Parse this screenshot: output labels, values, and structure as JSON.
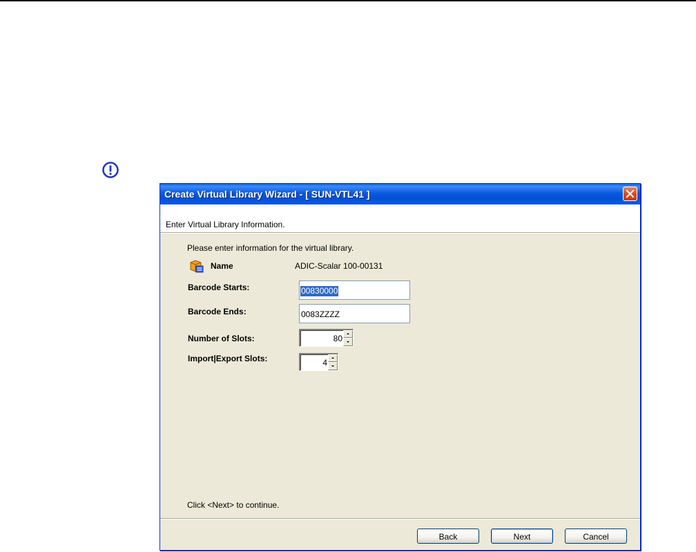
{
  "dialog": {
    "title": "Create Virtual Library Wizard - [ SUN-VTL41 ]",
    "header": "Enter Virtual Library Information.",
    "intro": "Please enter information for the virtual library.",
    "footer": "Click <Next> to continue."
  },
  "fields": {
    "name_label": "Name",
    "name_value": "ADIC-Scalar 100-00131",
    "barcode_starts_label": "Barcode Starts:",
    "barcode_starts_value": "00830000",
    "barcode_ends_label": "Barcode Ends:",
    "barcode_ends_value": "0083ZZZZ",
    "slots_label": "Number of Slots:",
    "slots_value": "80",
    "ie_slots_label": "Import|Export Slots:",
    "ie_slots_value": "4"
  },
  "buttons": {
    "back": "Back",
    "next": "Next",
    "cancel": "Cancel"
  },
  "colors": {
    "titlebar": "#0A5AE0",
    "dialog_bg": "#ECE9D8",
    "selection": "#316AC5",
    "note_icon": "#1E33C8"
  },
  "icons": {
    "note": "important-note-icon",
    "close": "close-icon",
    "library": "library-icon"
  }
}
